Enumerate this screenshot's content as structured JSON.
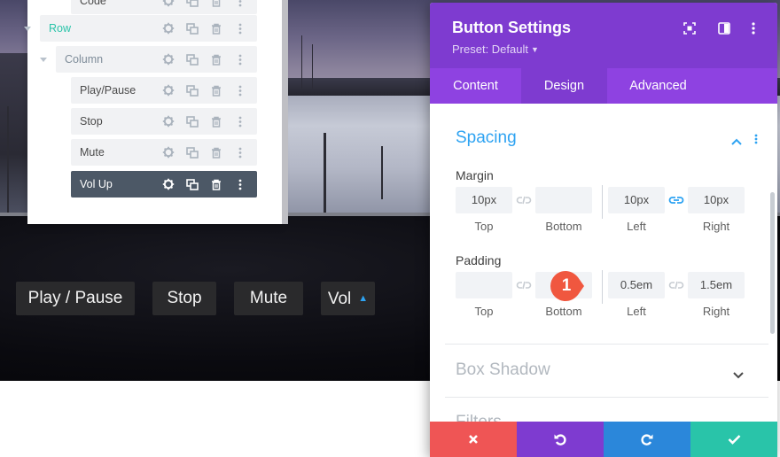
{
  "layers": {
    "items": [
      {
        "label": "Code",
        "depth": 3
      },
      {
        "label": "Row",
        "depth": 1
      },
      {
        "label": "Column",
        "depth": 2
      },
      {
        "label": "Play/Pause",
        "depth": 3
      },
      {
        "label": "Stop",
        "depth": 3
      },
      {
        "label": "Mute",
        "depth": 3
      },
      {
        "label": "Vol Up",
        "depth": 3,
        "active": true
      }
    ],
    "colors": {
      "row_label": "#29c4a9",
      "column_label": "#7e8c99",
      "active_bg": "#4c5866"
    }
  },
  "video": {
    "buttons": [
      "Play / Pause",
      "Stop",
      "Mute",
      "Vol"
    ]
  },
  "modal": {
    "title": "Button Settings",
    "preset": "Preset: Default",
    "tabs": [
      "Content",
      "Design",
      "Advanced"
    ],
    "active_tab": "Design",
    "spacing": {
      "title": "Spacing",
      "margin": {
        "label": "Margin",
        "fields": [
          {
            "value": "10px",
            "sub": "Top"
          },
          {
            "value": "",
            "sub": "Bottom"
          },
          {
            "value": "10px",
            "sub": "Left"
          },
          {
            "value": "10px",
            "sub": "Right"
          }
        ]
      },
      "padding": {
        "label": "Padding",
        "fields": [
          {
            "value": "",
            "sub": "Top"
          },
          {
            "value": "",
            "sub": "Bottom"
          },
          {
            "value": "0.5em",
            "sub": "Left"
          },
          {
            "value": "1.5em",
            "sub": "Right"
          }
        ]
      }
    },
    "sections": [
      "Box Shadow",
      "Filters"
    ],
    "marker": "1",
    "colors": {
      "header": "#7e3bd0",
      "tabs": "#8e42e1",
      "accent": "#2ea3f2",
      "cancel": "#ef5555",
      "undo": "#7e3bd0",
      "redo": "#2b87da",
      "save": "#29c4a9",
      "marker": "#f0573f"
    }
  }
}
